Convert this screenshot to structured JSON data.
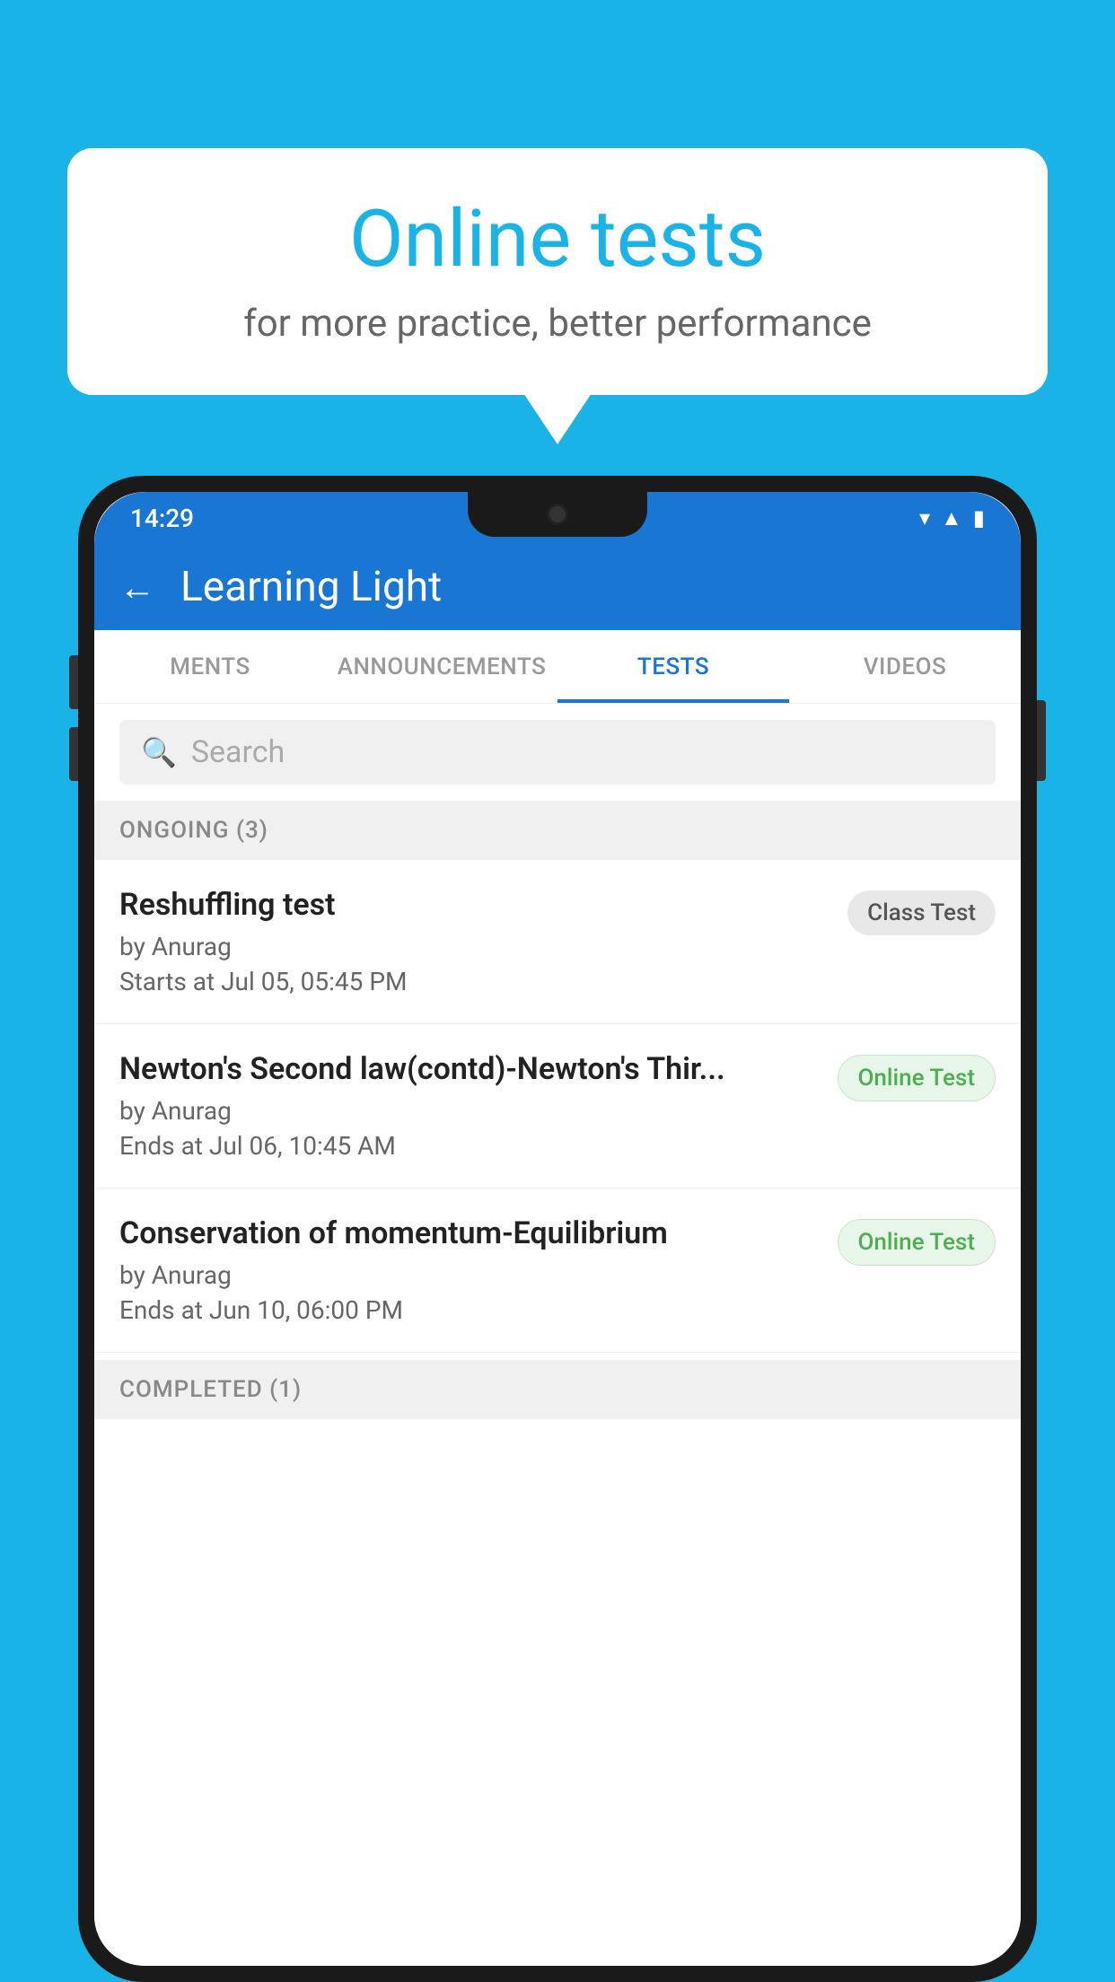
{
  "background": {
    "color": "#1ab3e8"
  },
  "speech_bubble": {
    "title": "Online tests",
    "subtitle": "for more practice, better performance"
  },
  "phone": {
    "status_bar": {
      "time": "14:29",
      "icons": [
        "wifi",
        "signal",
        "battery"
      ]
    },
    "app_bar": {
      "back_label": "←",
      "title": "Learning Light"
    },
    "tabs": [
      {
        "label": "MENTS",
        "active": false
      },
      {
        "label": "ANNOUNCEMENTS",
        "active": false
      },
      {
        "label": "TESTS",
        "active": true
      },
      {
        "label": "VIDEOS",
        "active": false
      }
    ],
    "search": {
      "placeholder": "Search"
    },
    "sections": [
      {
        "header": "ONGOING (3)",
        "items": [
          {
            "name": "Reshuffling test",
            "author": "by Anurag",
            "time_label": "Starts at",
            "time": "Jul 05, 05:45 PM",
            "badge": "Class Test",
            "badge_type": "class"
          },
          {
            "name": "Newton's Second law(contd)-Newton's Thir...",
            "author": "by Anurag",
            "time_label": "Ends at",
            "time": "Jul 06, 10:45 AM",
            "badge": "Online Test",
            "badge_type": "online"
          },
          {
            "name": "Conservation of momentum-Equilibrium",
            "author": "by Anurag",
            "time_label": "Ends at",
            "time": "Jun 10, 06:00 PM",
            "badge": "Online Test",
            "badge_type": "online"
          }
        ]
      }
    ],
    "completed_header": "COMPLETED (1)"
  }
}
